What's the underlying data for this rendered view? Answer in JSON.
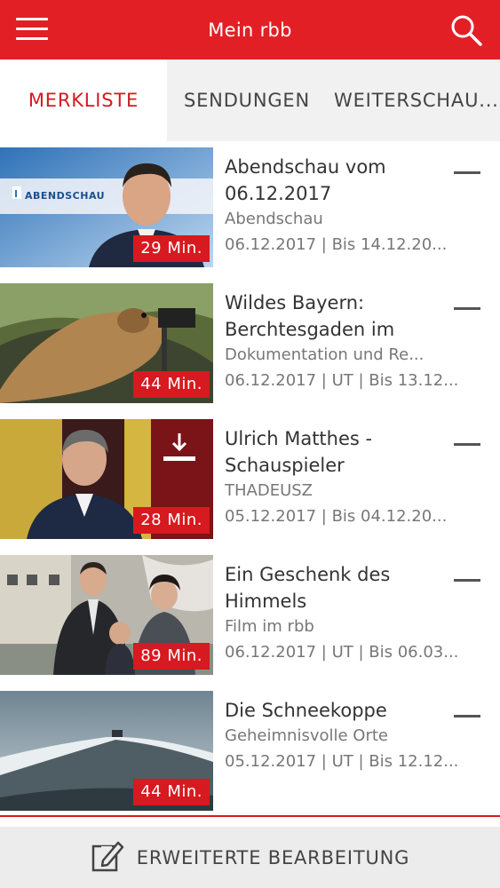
{
  "header": {
    "title": "Mein rbb",
    "menu_icon": "hamburger-menu-icon",
    "search_icon": "search-icon",
    "color": "#e31f26"
  },
  "tabs": [
    {
      "label": "MERKLISTE",
      "active": true
    },
    {
      "label": "SENDUNGEN",
      "active": false
    },
    {
      "label": "WEITERSCHAU...",
      "active": false
    }
  ],
  "items": [
    {
      "title": "Abendschau vom 06.12.2017",
      "subtitle": "Abendschau",
      "meta": "06.12.2017 | Bis 14.12.20...",
      "duration": "29 Min.",
      "thumb_logo": "ABENDSCHAU",
      "downloaded": false
    },
    {
      "title": "Wildes Bayern: Berchtesgaden im",
      "subtitle": "Dokumentation und Re...",
      "meta": "06.12.2017 | UT | Bis 13.12...",
      "duration": "44 Min.",
      "downloaded": false
    },
    {
      "title": "Ulrich Matthes - Schauspieler",
      "subtitle": "THADEUSZ",
      "meta": "05.12.2017 | Bis 04.12.20...",
      "duration": "28 Min.",
      "downloaded": true
    },
    {
      "title": "Ein Geschenk des Himmels",
      "subtitle": "Film im rbb",
      "meta": "06.12.2017 | UT | Bis 06.03...",
      "duration": "89 Min.",
      "downloaded": false
    },
    {
      "title": "Die Schneekoppe",
      "subtitle": "Geheimnisvolle Orte",
      "meta": "05.12.2017 | UT | Bis 12.12...",
      "duration": "44 Min.",
      "downloaded": false
    }
  ],
  "bottom_bar": {
    "label": "ERWEITERTE BEARBEITUNG",
    "icon": "edit-icon"
  },
  "colors": {
    "accent": "#d71920",
    "tab_bg": "#f1f1f1",
    "bottom_bg": "#ececec"
  }
}
